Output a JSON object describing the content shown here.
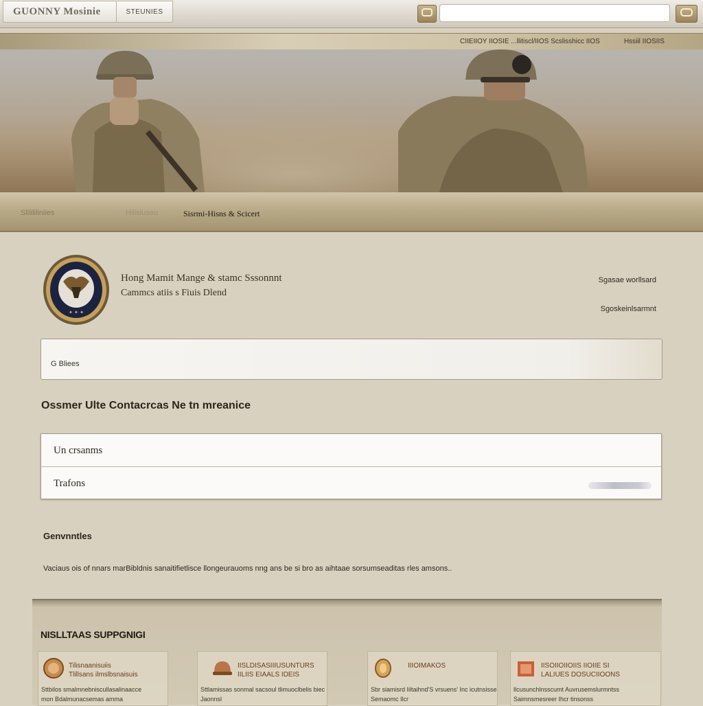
{
  "header": {
    "brand": "GUONNY Mosinie",
    "brand_tab": "STEUNIES",
    "search": {
      "placeholder": "",
      "value": ""
    },
    "left_button_icon": "chat-icon",
    "right_button_icon": "message-icon"
  },
  "nav": {
    "links": [
      "CIIEIIOY IIOSIE ...llitiscl/IIOS Scslisshicc IIOS",
      "Hssiil IIOSIIS"
    ]
  },
  "hero": {
    "links": [
      "Slilililiniies",
      "Hilisiuseu",
      "Sisrmi-Hisns & Scicert"
    ]
  },
  "org": {
    "line1": "Hong Mamit Mange & stamc Sssonnnt",
    "line2": "Cammcs atiis s Fiuis Dlend",
    "side_links": [
      "Sgasae worllsard",
      "Sgoskeinlsarmnt"
    ],
    "seal_alt": "ccvet seal"
  },
  "filter": {
    "label": "G Bliees"
  },
  "section_title": "Ossmer  Ulte Contacrcas Ne tn mreanice",
  "form": {
    "rows": [
      {
        "label": "Un crsanms"
      },
      {
        "label": "Trafons"
      }
    ]
  },
  "comments": {
    "heading": "Genvnntles",
    "text": "Vaciaus ois of nnars marBibldnis sanaitifietlisce llongeurauoms nng ans be si bro as aihtaae sorsumseaditas rles amsons.."
  },
  "support": {
    "heading": "NISLLTAAS SUPPGNIGI",
    "cards": [
      {
        "icon": "badge-icon",
        "title1": "Tilisnaanisuiis",
        "title2": "Tlillsans ilmslbsnaisuis",
        "desc1": "Sttbilos smalmnebniscullasalinaacce",
        "desc2": "mon Bdalmunacsemas amma"
      },
      {
        "icon": "helmet-icon",
        "title1": "IISLDISASIIIUSUNTURS",
        "title2": "IILIIS EIAALS IDEIS",
        "desc1": "Sttlamissas sonmal sacsoul tlimuoclbelis biec",
        "desc2": "Jaonnsl"
      },
      {
        "icon": "coin-icon",
        "title1": "IIIOIMAKOS",
        "title2": "",
        "desc1": "Sbr siamisrd Iiltaihnd'S vrsuens' Inc icutnsisse",
        "desc2": "Semaomc Ilcr"
      },
      {
        "icon": "flag-icon",
        "title1": "IISOIIOIIOIIS IIOIIE  SI",
        "title2": "LALIUES DOSUCIIOONS",
        "desc1": "llcusunchlnsscumt Auvrusemslurmntss",
        "desc2": "Saimnsmesreer Ihcr tinsonss"
      }
    ]
  },
  "colors": {
    "background": "#d9d1bf",
    "accent": "#9c8458",
    "panel": "#cdc3ad"
  }
}
